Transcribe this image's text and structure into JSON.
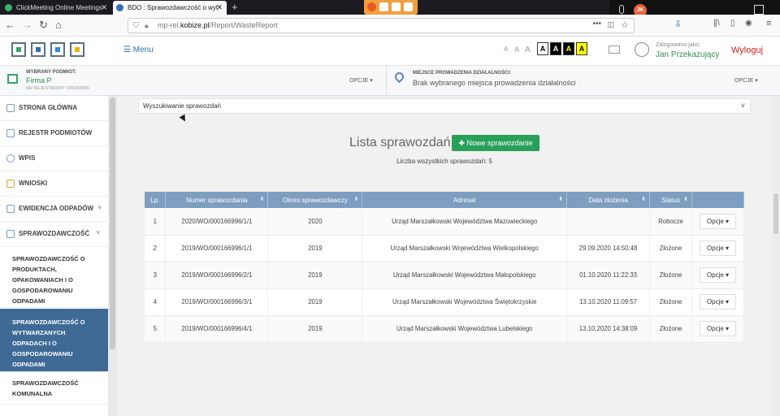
{
  "browser": {
    "tabs": [
      {
        "title": "ClickMeeting Online Meetings",
        "icon_color": "#3bb273"
      },
      {
        "title": "BDO : Sprawozdawczość o wyt",
        "icon_color": "#2d6fb3"
      }
    ],
    "url_prefix": "mp-rel.",
    "url_domain": "kobize.pl",
    "url_path": "/Report/WasteReport",
    "camera_initials": "JK"
  },
  "header": {
    "menu_label": "Menu",
    "font_sizes": [
      "A",
      "A",
      "A"
    ],
    "contrast_options": [
      "A",
      "A",
      "A",
      "A"
    ],
    "logged_as_label": "Zalogowano jako:",
    "user_name": "Jan Przekazujący",
    "logout_label": "Wyloguj"
  },
  "subject": {
    "label": "WYBRANY PODMIOT:",
    "name": "Firma P",
    "registry": "NR REJESTROWY: 000166996",
    "options_label": "OPCJE",
    "place_label": "MIEJSCE PROWADZENIA DZIAŁALNOŚCI:",
    "place_value": "Brak wybranego miejsca prowadzenia działalności",
    "place_options_label": "OPCJE"
  },
  "sidebar": {
    "items": [
      {
        "label": "STRONA GŁÓWNA"
      },
      {
        "label": "REJESTR PODMIOTÓW"
      },
      {
        "label": "WPIS"
      },
      {
        "label": "WNIOSKI"
      },
      {
        "label": "EWIDENCJA ODPADÓW"
      },
      {
        "label": "SPRAWOZDAWCZOŚĆ"
      }
    ],
    "subitems": [
      {
        "label": "SPRAWOZDAWCZOŚĆ O PRODUKTACH, OPAKOWANIACH I O GOSPODAROWANIU ODPADAMI"
      },
      {
        "label": "SPRAWOZDAWCZOŚĆ O WYTWARZANYCH ODPADACH I O GOSPODAROWANIU ODPADAMI"
      },
      {
        "label": "SPRAWOZDAWCZOŚĆ KOMUNALNA"
      }
    ]
  },
  "main": {
    "search_label": "Wyszukiwanie sprawozdań",
    "list_title": "Lista sprawozdań",
    "new_button_label": "Nowe sprawozdanie",
    "count_text": "Liczba wszystkich sprawozdań: 5",
    "table": {
      "headers": [
        "Lp.",
        "Numer sprawozdania",
        "Okres sprawozdawczy",
        "Adresat",
        "Data złożenia",
        "Status",
        ""
      ],
      "rows": [
        [
          "1",
          "2020/WO/000166996/1/1",
          "2020",
          "Urząd Marszałkowski Województwa Mazowieckiego",
          "",
          "Robocze",
          "Opcje"
        ],
        [
          "2",
          "2019/WO/000166996/1/1",
          "2019",
          "Urząd Marszałkowski Województwa Wielkopolskiego",
          "29.09.2020 14:50:48",
          "Złożone",
          "Opcje"
        ],
        [
          "3",
          "2019/WO/000166996/2/1",
          "2019",
          "Urząd Marszałkowski Województwa Małopolskiego",
          "01.10.2020 11:22:33",
          "Złożone",
          "Opcje"
        ],
        [
          "4",
          "2019/WO/000166996/3/1",
          "2019",
          "Urząd Marszałkowski Województwa Świętokrzyskie",
          "13.10.2020 11:09:57",
          "Złożone",
          "Opcje"
        ],
        [
          "5",
          "2019/WO/000166996/4/1",
          "2019",
          "Urząd Marszałkowski Województwa Lubelskiego",
          "13.10.2020 14:38:09",
          "Złożone",
          "Opcje"
        ]
      ]
    }
  }
}
